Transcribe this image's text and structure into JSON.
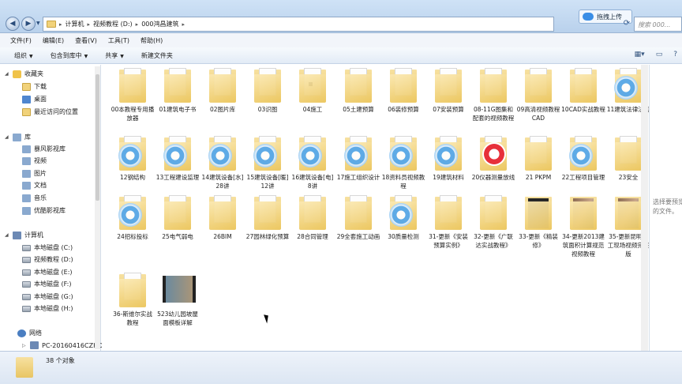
{
  "address": {
    "crumbs": [
      "计算机",
      "视频教程 (D:)",
      "000鸿昌建筑"
    ]
  },
  "search": {
    "placeholder": "搜索 000..."
  },
  "upload_button": "拖拽上传",
  "menu": [
    "文件(F)",
    "编辑(E)",
    "查看(V)",
    "工具(T)",
    "帮助(H)"
  ],
  "toolbar": {
    "organize": "组织",
    "include_library": "包含到库中",
    "share": "共享",
    "new_folder": "新建文件夹"
  },
  "nav": {
    "favorites": "收藏夹",
    "downloads": "下载",
    "desktop": "桌面",
    "recent": "最近访问的位置",
    "libraries": "库",
    "storm": "暴风影视库",
    "videos": "视频",
    "pictures": "图片",
    "documents": "文档",
    "music": "音乐",
    "youku": "优酷影视库",
    "computer": "计算机",
    "drives": [
      "本地磁盘 (C:)",
      "视频教程 (D:)",
      "本地磁盘 (E:)",
      "本地磁盘 (F:)",
      "本地磁盘 (G:)",
      "本地磁盘 (H:)"
    ],
    "network": "网络",
    "pc": "PC-20160416CZHO"
  },
  "files": [
    {
      "name": "00本教程专用播放器",
      "icon": "folder"
    },
    {
      "name": "01建筑电子书",
      "icon": "folder"
    },
    {
      "name": "02图片库",
      "icon": "folder"
    },
    {
      "name": "03识图",
      "icon": "folder"
    },
    {
      "name": "04施工",
      "icon": "folder-dot"
    },
    {
      "name": "05土建预算",
      "icon": "folder"
    },
    {
      "name": "06装修预算",
      "icon": "folder"
    },
    {
      "name": "07安装预算",
      "icon": "folder"
    },
    {
      "name": "08-11G图集和配套的视频教程",
      "icon": "folder"
    },
    {
      "name": "09高清视频教程CAD",
      "icon": "folder"
    },
    {
      "name": "10CAD实战教程",
      "icon": "folder"
    },
    {
      "name": "11建筑法律法规",
      "icon": "badge"
    },
    {
      "name": "12钢结构",
      "icon": "badge"
    },
    {
      "name": "13工程建设监理",
      "icon": "badge"
    },
    {
      "name": "14建筑设备[水] 28讲",
      "icon": "badge"
    },
    {
      "name": "15建筑设备[暖] 12讲",
      "icon": "badge"
    },
    {
      "name": "16建筑设备[电] 8讲",
      "icon": "badge"
    },
    {
      "name": "17施工组织设计",
      "icon": "badge"
    },
    {
      "name": "18资料员视频教程",
      "icon": "badge"
    },
    {
      "name": "19建筑材料",
      "icon": "badge"
    },
    {
      "name": "20仪器测量放线",
      "icon": "play"
    },
    {
      "name": "21 PKPM",
      "icon": "folder"
    },
    {
      "name": "22工程项目管理",
      "icon": "badge"
    },
    {
      "name": "23安全",
      "icon": "folder"
    },
    {
      "name": "24招标投标",
      "icon": "badge"
    },
    {
      "name": "25电气弱电",
      "icon": "folder"
    },
    {
      "name": "26BIM",
      "icon": "folder"
    },
    {
      "name": "27园林绿化预算",
      "icon": "folder"
    },
    {
      "name": "28合同管理",
      "icon": "folder"
    },
    {
      "name": "29全套施工动画",
      "icon": "folder"
    },
    {
      "name": "30质量检测",
      "icon": "badge"
    },
    {
      "name": "31-更新《安装预算实例》",
      "icon": "folder"
    },
    {
      "name": "32-更新《广联达实战教程》",
      "icon": "folder"
    },
    {
      "name": "33-更新《精装修》",
      "icon": "dark"
    },
    {
      "name": "34-更新2013建筑面积计算规范视频教程",
      "icon": "photo"
    },
    {
      "name": "35-更新昆明施工现场视频完整版",
      "icon": "photo"
    },
    {
      "name": "36-斯维尔实战教程",
      "icon": "folder"
    },
    {
      "name": "523幼儿园坡屋面模板详解",
      "icon": "video"
    }
  ],
  "preview_text": [
    "选择要预览",
    "的文件。"
  ],
  "status": {
    "count": "38 个对象"
  }
}
